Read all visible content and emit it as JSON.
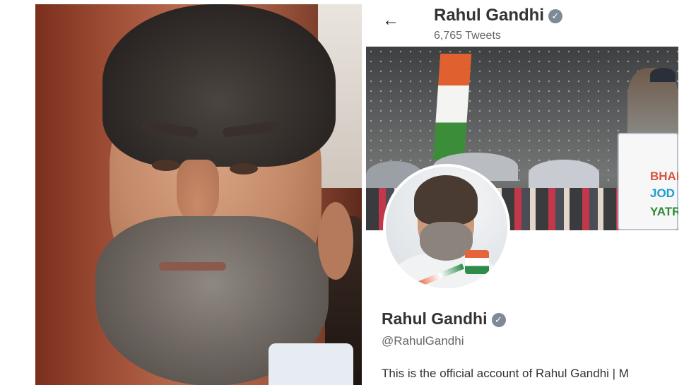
{
  "twitter_profile": {
    "header": {
      "name": "Rahul Gandhi",
      "tweet_count": "6,765 Tweets"
    },
    "banner": {
      "sign_lines": [
        "BHAR",
        "JOD",
        "YATR"
      ]
    },
    "profile": {
      "name": "Rahul Gandhi",
      "handle": "@RahulGandhi",
      "bio": "This is the official account of Rahul Gandhi | M"
    },
    "icons": [
      "back-arrow-icon",
      "verified-badge-icon"
    ]
  },
  "colors": {
    "name_text": "#333333",
    "secondary_text": "#666666",
    "verified_badge": "#7f8a97",
    "flag_saffron": "#e0612f",
    "flag_green": "#3b8d39"
  }
}
